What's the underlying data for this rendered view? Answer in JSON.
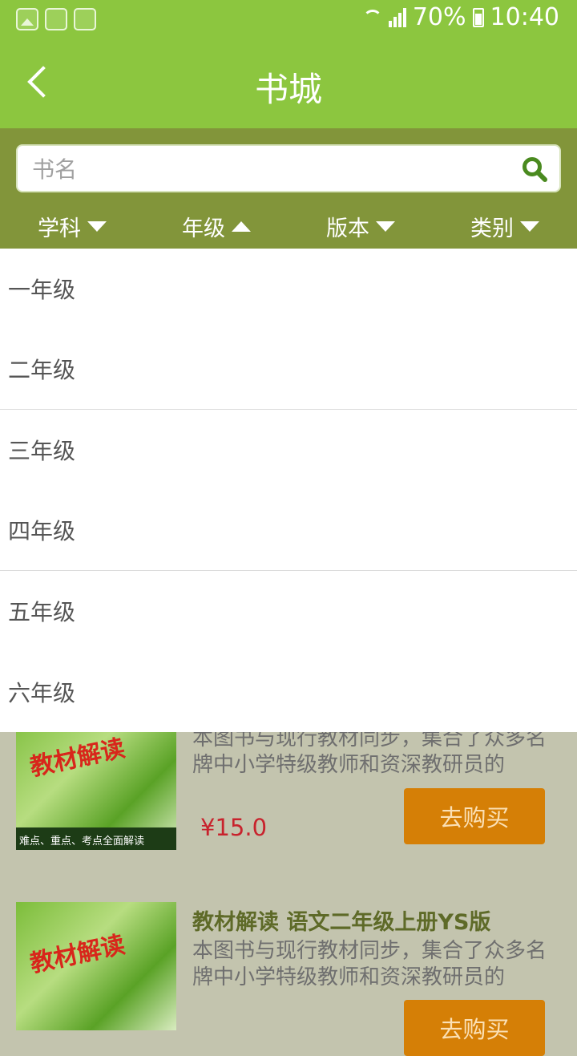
{
  "status_bar": {
    "battery": "70%",
    "time": "10:40",
    "icons": [
      "gallery-icon",
      "app-icon",
      "app-icon",
      "wifi-icon",
      "signal-icon",
      "battery-icon"
    ]
  },
  "app_bar": {
    "title": "书城",
    "back_icon": "chevron-left-icon"
  },
  "search": {
    "placeholder": "书名",
    "icon": "search-icon"
  },
  "filters": [
    {
      "label": "学科",
      "state": "collapsed"
    },
    {
      "label": "年级",
      "state": "expanded"
    },
    {
      "label": "版本",
      "state": "collapsed"
    },
    {
      "label": "类别",
      "state": "collapsed"
    }
  ],
  "grade_dropdown": {
    "items": [
      "一年级",
      "二年级",
      "三年级",
      "四年级",
      "五年级",
      "六年级"
    ]
  },
  "books": [
    {
      "title": "",
      "desc": "本图书与现行教材同步，集合了众多名牌中小学特级教师和资深教研员的",
      "price": "¥15.0",
      "buy_label": "去购买",
      "cover_strip": "难点、重点、考点全面解读",
      "cover_text": "教材解读"
    },
    {
      "title": "教材解读 语文二年级上册YS版",
      "desc": "本图书与现行教材同步，集合了众多名牌中小学特级教师和资深教研员的",
      "price": "",
      "buy_label": "去购买",
      "cover_text": "教材解读"
    }
  ],
  "colors": {
    "primary": "#8cc63f",
    "filter_bar": "#82953a",
    "buy_button": "#d57f06",
    "price": "#c8232d"
  }
}
